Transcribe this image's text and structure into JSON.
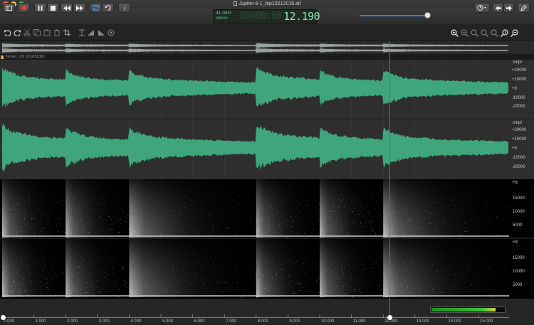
{
  "window": {
    "title": "Jupiter-8 1_bip10212019.aif"
  },
  "lcd": {
    "rate": "44.1kHz",
    "channels": "stereo",
    "dim_digits": "00000:00",
    "time": "12.190"
  },
  "labelbar": {
    "text": "Tempo: 120 ()0.9251383"
  },
  "waveform": {
    "units": "smpl",
    "ticks": [
      "+20000",
      "+10000",
      "+0",
      "-10000",
      "-20000"
    ]
  },
  "spectrogram": {
    "units": "Hz",
    "ticks": [
      "15000",
      "10000",
      "5000"
    ]
  },
  "timeline": {
    "ticks": [
      "0.000",
      "1.000",
      "2.000",
      "3.000",
      "4.000",
      "5.000",
      "6.000",
      "7.000",
      "8.000",
      "9.000",
      "10.000",
      "11.000",
      "12.000",
      "13.000",
      "14.000",
      "15.000"
    ]
  },
  "playhead": {
    "time_seconds": 12.19
  },
  "level_meter": {
    "level": 0.88
  },
  "transients_seconds": [
    0.0,
    2.0,
    4.0,
    8.0,
    10.0,
    12.0
  ],
  "colors": {
    "waveform": "#3fa57d",
    "playhead": "#e03b3b",
    "selection_blue": "#3d7bd6"
  }
}
